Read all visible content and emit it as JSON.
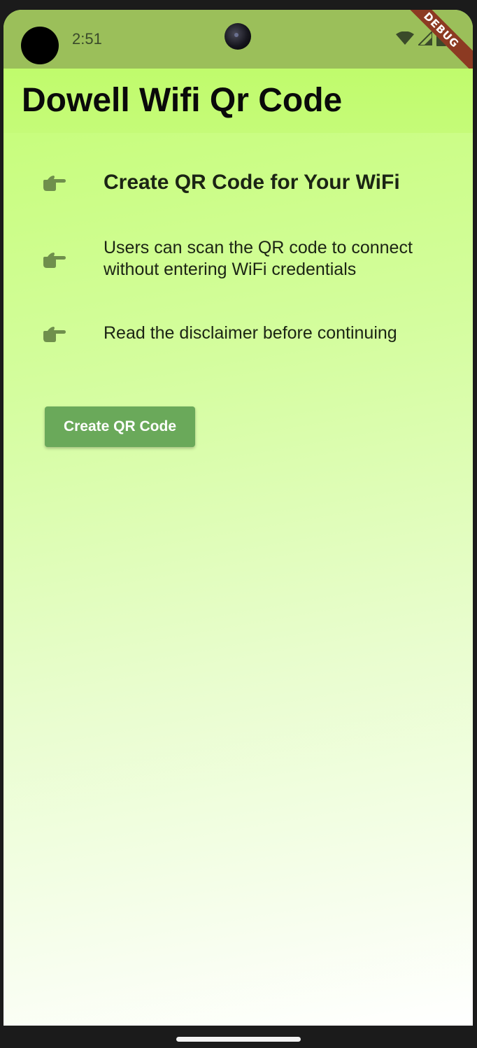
{
  "status_bar": {
    "time": "2:51",
    "icons": [
      "wifi-icon",
      "signal-icon",
      "battery-icon"
    ],
    "debug_label": "DEBUG"
  },
  "app_bar": {
    "title": "Dowell Wifi Qr Code"
  },
  "features": [
    {
      "icon": "pointing-hand-icon",
      "text": "Create QR Code for Your WiFi"
    },
    {
      "icon": "pointing-hand-icon",
      "text": "Users can scan the QR code to connect without entering WiFi credentials"
    },
    {
      "icon": "pointing-hand-icon",
      "text": "Read the disclaimer before continuing"
    }
  ],
  "actions": {
    "create_label": "Create QR Code"
  },
  "colors": {
    "status_bar": "#9bbf5a",
    "app_bar": "#c0fb6c",
    "gradient_end": "#ffffff",
    "button": "#6aa95a",
    "icon": "#6f8f4c",
    "debug_banner": "#8c3a22"
  }
}
